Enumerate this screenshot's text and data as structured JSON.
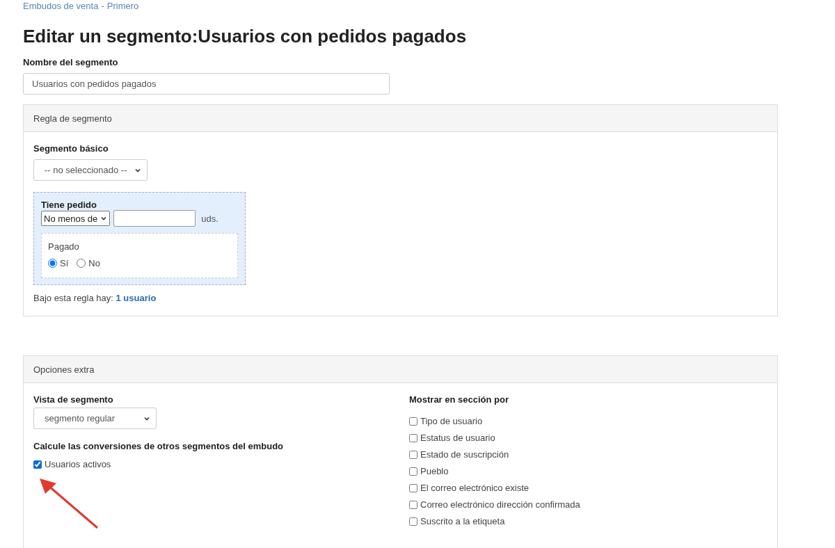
{
  "breadcrumb": [
    {
      "label": "Embudos de venta"
    },
    {
      "label": "Primero"
    }
  ],
  "breadcrumb_separator": "-",
  "title": "Editar un segmento:Usuarios con pedidos pagados",
  "name_field": {
    "label": "Nombre del segmento",
    "value": "Usuarios con pedidos pagados"
  },
  "rule_panel": {
    "header": "Regla de segmento",
    "basic_segment": {
      "label": "Segmento básico",
      "value": "-- no seleccionado --"
    },
    "condition": {
      "title": "Tiene pedido",
      "operator": "No menos de",
      "unit": "uds.",
      "paid": {
        "label": "Pagado",
        "options": [
          {
            "label": "Sí",
            "selected": true
          },
          {
            "label": "No",
            "selected": false
          }
        ]
      }
    },
    "summary": {
      "text": "Bajo esta regla hay:",
      "link": "1 usuario"
    }
  },
  "extra_panel": {
    "header": "Opciones extra",
    "view": {
      "label": "Vista de segmento",
      "value": "segmento regular"
    },
    "conversions": {
      "label": "Calcule las conversiones de otros segmentos del embudo",
      "items": [
        {
          "label": "Usuarios activos",
          "checked": true
        }
      ]
    },
    "section_by": {
      "label": "Mostrar en sección por",
      "items": [
        {
          "label": "Tipo de usuario",
          "checked": false
        },
        {
          "label": "Estatus de usuario",
          "checked": false
        },
        {
          "label": "Estado de suscripción",
          "checked": false
        },
        {
          "label": "Pueblo",
          "checked": false
        },
        {
          "label": "El correo electrónico existe",
          "checked": false
        },
        {
          "label": "Correo electrónico dirección confirmada",
          "checked": false
        },
        {
          "label": "Suscrito a la etiqueta",
          "checked": false
        }
      ]
    }
  }
}
